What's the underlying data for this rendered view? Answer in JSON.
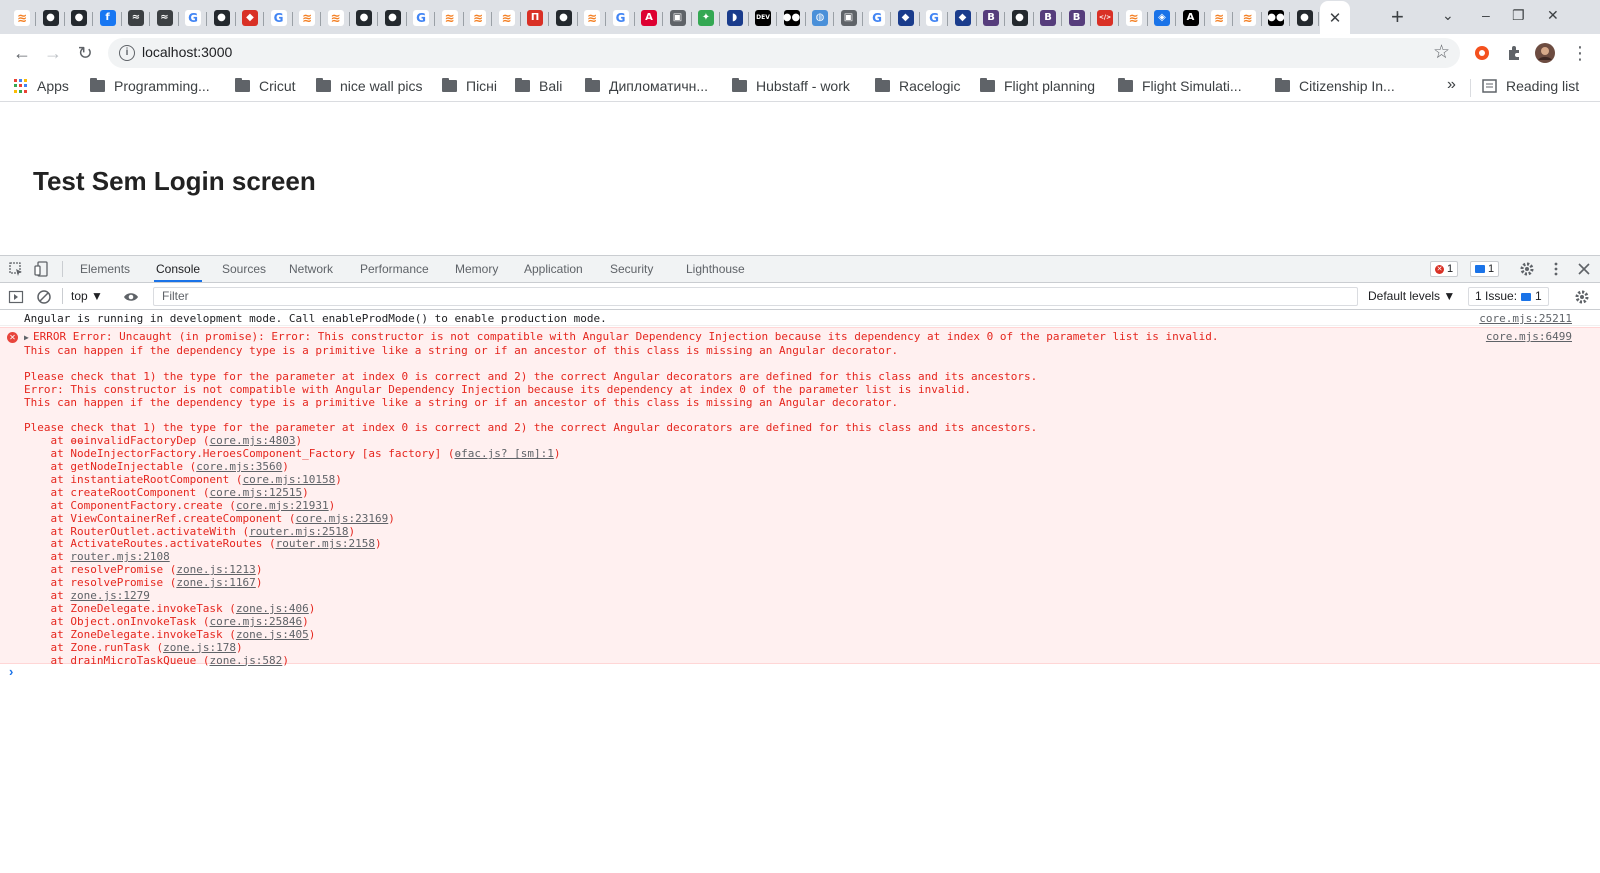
{
  "browser": {
    "tabs": [
      {
        "icon": "stackoverflow-icon",
        "color": "#f48024",
        "glyph": "≋"
      },
      {
        "icon": "github-icon",
        "color": "#24292e",
        "glyph": "●"
      },
      {
        "icon": "github-icon",
        "color": "#24292e",
        "glyph": "●"
      },
      {
        "icon": "facebook-icon",
        "color": "#1877f2",
        "glyph": "f"
      },
      {
        "icon": "bird-icon",
        "color": "#3c4043",
        "glyph": "≈"
      },
      {
        "icon": "bird-icon",
        "color": "#3c4043",
        "glyph": "≈"
      },
      {
        "icon": "google-icon",
        "color": "#4285f4",
        "glyph": "G"
      },
      {
        "icon": "github-icon",
        "color": "#24292e",
        "glyph": "●"
      },
      {
        "icon": "shield-icon",
        "color": "#d93025",
        "glyph": "◆"
      },
      {
        "icon": "google-icon",
        "color": "#4285f4",
        "glyph": "G"
      },
      {
        "icon": "stackoverflow-icon",
        "color": "#f48024",
        "glyph": "≋"
      },
      {
        "icon": "stackoverflow-icon",
        "color": "#f48024",
        "glyph": "≋"
      },
      {
        "icon": "github-icon",
        "color": "#24292e",
        "glyph": "●"
      },
      {
        "icon": "github-icon",
        "color": "#24292e",
        "glyph": "●"
      },
      {
        "icon": "google-icon",
        "color": "#4285f4",
        "glyph": "G"
      },
      {
        "icon": "stackoverflow-icon",
        "color": "#f48024",
        "glyph": "≋"
      },
      {
        "icon": "stackoverflow-icon",
        "color": "#f48024",
        "glyph": "≋"
      },
      {
        "icon": "stackoverflow-icon",
        "color": "#f48024",
        "glyph": "≋"
      },
      {
        "icon": "red-square-icon",
        "color": "#d93025",
        "glyph": "П"
      },
      {
        "icon": "github-icon",
        "color": "#24292e",
        "glyph": "●"
      },
      {
        "icon": "stackoverflow-icon",
        "color": "#f48024",
        "glyph": "≋"
      },
      {
        "icon": "google-icon",
        "color": "#4285f4",
        "glyph": "G"
      },
      {
        "icon": "angular-icon",
        "color": "#dd0031",
        "glyph": "A"
      },
      {
        "icon": "window-icon",
        "color": "#5f6368",
        "glyph": "▣"
      },
      {
        "icon": "pinwheel-icon",
        "color": "#34a853",
        "glyph": "✦"
      },
      {
        "icon": "blue-shield-icon",
        "color": "#1a3c8c",
        "glyph": "◗"
      },
      {
        "icon": "dev-icon",
        "color": "#000000",
        "glyph": "DEV"
      },
      {
        "icon": "medium-icon",
        "color": "#000000",
        "glyph": "●●"
      },
      {
        "icon": "globe-icon",
        "color": "#4a90d9",
        "glyph": "◍"
      },
      {
        "icon": "window-icon",
        "color": "#5f6368",
        "glyph": "▣"
      },
      {
        "icon": "google-icon",
        "color": "#4285f4",
        "glyph": "G"
      },
      {
        "icon": "shield-icon",
        "color": "#1a3c8c",
        "glyph": "◆"
      },
      {
        "icon": "google-icon",
        "color": "#4285f4",
        "glyph": "G"
      },
      {
        "icon": "shield-icon",
        "color": "#1a3c8c",
        "glyph": "◆"
      },
      {
        "icon": "bootstrap-icon",
        "color": "#563d7c",
        "glyph": "B"
      },
      {
        "icon": "github-icon",
        "color": "#24292e",
        "glyph": "●"
      },
      {
        "icon": "bootstrap-icon",
        "color": "#563d7c",
        "glyph": "B"
      },
      {
        "icon": "bootstrap-icon",
        "color": "#563d7c",
        "glyph": "B"
      },
      {
        "icon": "code-icon",
        "color": "#d93025",
        "glyph": "</>"
      },
      {
        "icon": "stackoverflow-icon",
        "color": "#f48024",
        "glyph": "≋"
      },
      {
        "icon": "layers-icon",
        "color": "#1a73e8",
        "glyph": "◈"
      },
      {
        "icon": "a-letter-icon",
        "color": "#000000",
        "glyph": "A"
      },
      {
        "icon": "stackoverflow-icon",
        "color": "#f48024",
        "glyph": "≋"
      },
      {
        "icon": "stackoverflow-icon",
        "color": "#f48024",
        "glyph": "≋"
      },
      {
        "icon": "medium-icon",
        "color": "#000000",
        "glyph": "●●"
      },
      {
        "icon": "github-icon",
        "color": "#24292e",
        "glyph": "●"
      }
    ],
    "active_tab_close": "✕",
    "new_tab": "+",
    "window_controls": [
      "⌄",
      "–",
      "❐",
      "✕"
    ]
  },
  "toolbar": {
    "back": "←",
    "forward": "→",
    "reload": "↻",
    "url": "localhost:3000",
    "info": "i",
    "star": "☆",
    "menu": "⋮"
  },
  "bookmarks": {
    "apps_label": "Apps",
    "items": [
      "Programming...",
      "Cricut",
      "nice wall pics",
      "Пісні",
      "Bali",
      "Дипломатичн...",
      "Hubstaff - work",
      "Racelogic",
      "Flight planning",
      "Flight Simulati...",
      "Citizenship In..."
    ],
    "more": "»",
    "reading_list": "Reading list"
  },
  "page": {
    "title": "Test Sem Login screen"
  },
  "devtools": {
    "tabs": [
      "Elements",
      "Console",
      "Sources",
      "Network",
      "Performance",
      "Memory",
      "Application",
      "Security",
      "Lighthouse"
    ],
    "active_tab": "Console",
    "error_count": "1",
    "message_count": "1",
    "context": "top ▼",
    "filter_placeholder": "Filter",
    "levels": "Default levels ▼",
    "issues_label": "1 Issue:",
    "issues_count": "1",
    "info_message": "Angular is running in development mode. Call enableProdMode() to enable production mode.",
    "info_source": "core.mjs:25211",
    "error_source": "core.mjs:6499",
    "error_lines": [
      "ERROR Error: Uncaught (in promise): Error: This constructor is not compatible with Angular Dependency Injection because its dependency at index 0 of the parameter list is invalid.",
      "This can happen if the dependency type is a primitive like a string or if an ancestor of this class is missing an Angular decorator.",
      "",
      "Please check that 1) the type for the parameter at index 0 is correct and 2) the correct Angular decorators are defined for this class and its ancestors.",
      "Error: This constructor is not compatible with Angular Dependency Injection because its dependency at index 0 of the parameter list is invalid.",
      "This can happen if the dependency type is a primitive like a string or if an ancestor of this class is missing an Angular decorator.",
      "",
      "Please check that 1) the type for the parameter at index 0 is correct and 2) the correct Angular decorators are defined for this class and its ancestors."
    ],
    "stack": [
      {
        "fn": "ɵɵinvalidFactoryDep",
        "loc": "core.mjs:4803"
      },
      {
        "fn": "NodeInjectorFactory.HeroesComponent_Factory [as factory]",
        "loc": "ɵfac.js? [sm]:1"
      },
      {
        "fn": "getNodeInjectable",
        "loc": "core.mjs:3560"
      },
      {
        "fn": "instantiateRootComponent",
        "loc": "core.mjs:10158"
      },
      {
        "fn": "createRootComponent",
        "loc": "core.mjs:12515"
      },
      {
        "fn": "ComponentFactory.create",
        "loc": "core.mjs:21931"
      },
      {
        "fn": "ViewContainerRef.createComponent",
        "loc": "core.mjs:23169"
      },
      {
        "fn": "RouterOutlet.activateWith",
        "loc": "router.mjs:2518"
      },
      {
        "fn": "ActivateRoutes.activateRoutes",
        "loc": "router.mjs:2158"
      },
      {
        "fn": "",
        "loc": "router.mjs:2108"
      },
      {
        "fn": "resolvePromise",
        "loc": "zone.js:1213"
      },
      {
        "fn": "resolvePromise",
        "loc": "zone.js:1167"
      },
      {
        "fn": "",
        "loc": "zone.js:1279"
      },
      {
        "fn": "ZoneDelegate.invokeTask",
        "loc": "zone.js:406"
      },
      {
        "fn": "Object.onInvokeTask",
        "loc": "core.mjs:25846"
      },
      {
        "fn": "ZoneDelegate.invokeTask",
        "loc": "zone.js:405"
      },
      {
        "fn": "Zone.runTask",
        "loc": "zone.js:178"
      },
      {
        "fn": "drainMicroTaskQueue",
        "loc": "zone.js:582"
      }
    ],
    "prompt": "›"
  }
}
